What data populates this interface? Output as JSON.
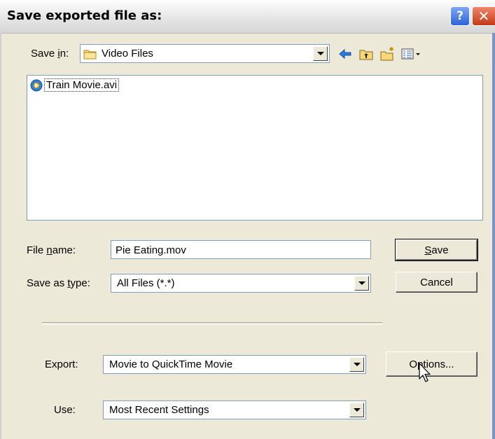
{
  "window": {
    "title": "Save exported file as:",
    "help_label": "?",
    "close_label": "✕"
  },
  "savein": {
    "label_pre": "Save ",
    "label_u": "i",
    "label_post": "n:",
    "value": "Video Files"
  },
  "files": [
    {
      "name": "Train Movie.avi",
      "icon": "avi-file-icon"
    }
  ],
  "filename": {
    "label_pre": "File ",
    "label_u": "n",
    "label_post": "ame:",
    "value": "Pie Eating.mov"
  },
  "savetype": {
    "label_pre": "Save as ",
    "label_u": "t",
    "label_post": "ype:",
    "value": "All Files (*.*)"
  },
  "buttons": {
    "save_u": "S",
    "save_post": "ave",
    "cancel": "Cancel",
    "options_pre": "Op",
    "options_post": "tions..."
  },
  "export": {
    "label": "Export:",
    "value": "Movie to QuickTime Movie"
  },
  "use": {
    "label": "Use:",
    "value": "Most Recent Settings"
  },
  "icons": {
    "folder": "folder-icon",
    "back": "back-arrow-icon",
    "up": "up-folder-icon",
    "newfolder": "new-folder-icon",
    "view": "view-menu-icon"
  }
}
